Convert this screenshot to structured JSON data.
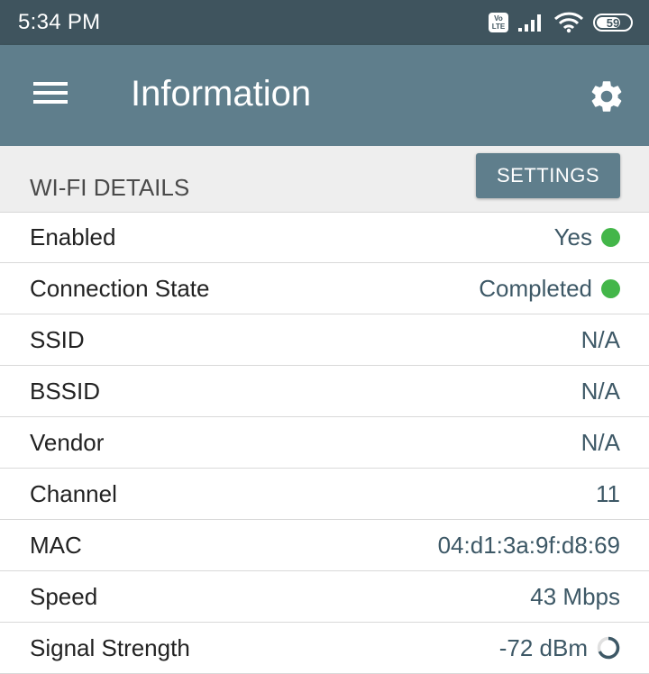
{
  "status_bar": {
    "time": "5:34 PM",
    "volte_top": "Vo",
    "volte_bottom": "LTE",
    "battery_level": "59",
    "icons": [
      "volte-icon",
      "signal-icon",
      "wifi-icon",
      "battery-icon"
    ]
  },
  "app_bar": {
    "title": "Information",
    "menu_icon": "menu-icon",
    "settings_icon": "gear-icon",
    "background": "#5f7e8c"
  },
  "section": {
    "title": "WI-FI DETAILS",
    "button_label": "SETTINGS"
  },
  "rows": [
    {
      "label": "Enabled",
      "value": "Yes",
      "indicator": "green-dot"
    },
    {
      "label": "Connection State",
      "value": "Completed",
      "indicator": "green-dot"
    },
    {
      "label": "SSID",
      "value": "N/A"
    },
    {
      "label": "BSSID",
      "value": "N/A"
    },
    {
      "label": "Vendor",
      "value": "N/A"
    },
    {
      "label": "Channel",
      "value": "11"
    },
    {
      "label": "MAC",
      "value": "04:d1:3a:9f:d8:69"
    },
    {
      "label": "Speed",
      "value": "43 Mbps"
    },
    {
      "label": "Signal Strength",
      "value": "-72 dBm",
      "indicator": "signal-ring"
    }
  ],
  "colors": {
    "status_bar": "#3f545e",
    "accent": "#5f7e8c",
    "value_text": "#3d5866",
    "indicator_green": "#43b649"
  }
}
